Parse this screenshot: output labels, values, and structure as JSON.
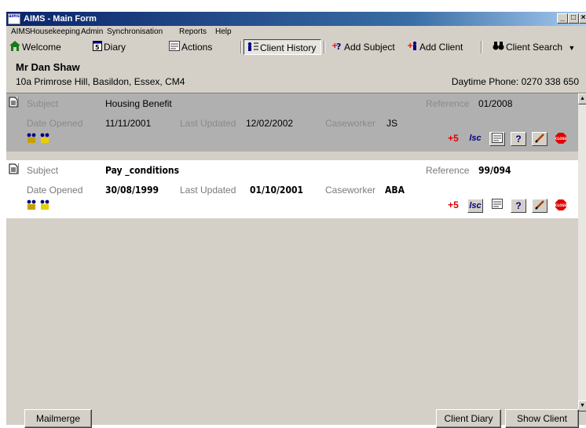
{
  "window": {
    "title": "AIMS - Main Form",
    "icon_text": "aims"
  },
  "menu": [
    "AIMS",
    "Housekeeping",
    "Admin",
    "Synchronisation",
    "Reports",
    "Help"
  ],
  "toolbar": {
    "welcome": "Welcome",
    "diary": "Diary",
    "actions": "Actions",
    "client_history": "Client History",
    "add_subject": "Add Subject",
    "add_client": "Add Client",
    "client_search": "Client Search"
  },
  "client": {
    "name": "Mr Dan Shaw",
    "address": "10a Primrose Hill, Basildon, Essex, CM4",
    "phone": "Daytime Phone: 0270 338 650"
  },
  "labels": {
    "subject": "Subject",
    "date_opened": "Date Opened",
    "last_updated": "Last Updated",
    "caseworker": "Caseworker",
    "reference": "Reference"
  },
  "records": [
    {
      "subject": "Housing Benefit",
      "date_opened": "11/11/2001",
      "last_updated": "12/02/2002",
      "caseworker": "JS",
      "reference": "01/2008",
      "selected": true
    },
    {
      "subject": "Pay _conditions",
      "date_opened": "30/08/1999",
      "last_updated": "01/10/2001",
      "caseworker": "ABA",
      "reference": "99/094",
      "selected": false
    }
  ],
  "record_icons": [
    "add-action-icon",
    "lsc-icon",
    "actions-icon",
    "help-icon",
    "edit-icon",
    "close-stop-icon"
  ],
  "record_icon_text": {
    "add": "+5",
    "lsc": "lsc",
    "help": "?",
    "stop": "CLOSE"
  },
  "buttons": {
    "mailmerge": "Mailmerge",
    "client_diary": "Client Diary",
    "show_client": "Show Client"
  },
  "colors": {
    "title_bar": "#0a246a",
    "window_bg": "#d4d0c8",
    "selected_row": "#b0b0b0",
    "accent_red": "#e00000",
    "accent_blue": "#0000c0"
  }
}
